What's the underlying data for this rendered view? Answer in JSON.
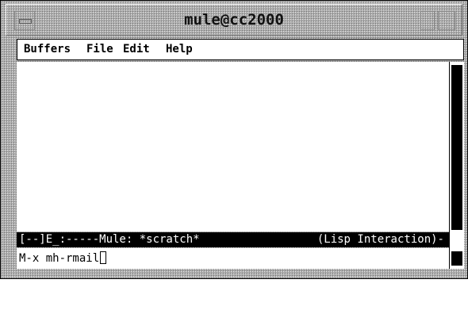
{
  "window": {
    "title": "mule@cc2000"
  },
  "menubar": {
    "items": [
      "Buffers",
      "File",
      "Edit",
      "Help"
    ]
  },
  "modeline": {
    "left": "[--]E_:-----Mule: *scratch*",
    "right": "(Lisp Interaction)-"
  },
  "minibuffer": {
    "text": "M-x mh-rmail"
  },
  "icons": {
    "window_menu": "window-menu-icon",
    "minimize": "minimize-icon",
    "maximize": "maximize-icon"
  },
  "colors": {
    "modeline_bg": "#000000",
    "modeline_fg": "#ffffff",
    "frame": "#b4b4b4"
  }
}
